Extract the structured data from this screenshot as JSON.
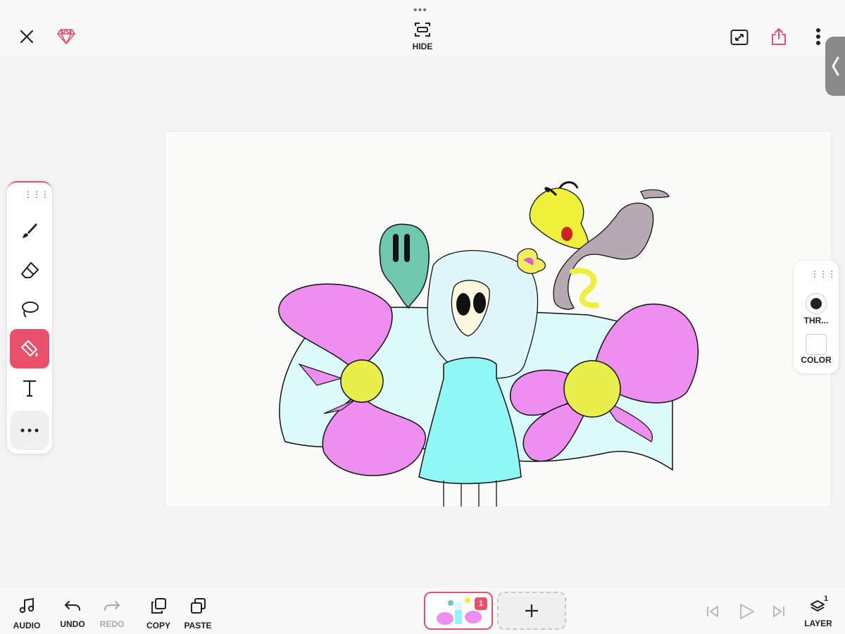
{
  "topbar": {
    "hide_label": "HIDE",
    "icons": [
      "close-icon",
      "gem-icon",
      "fullscreen-icon",
      "share-icon",
      "more-vertical-icon",
      "collapse-left-icon"
    ]
  },
  "toolbar": {
    "tools": [
      "brush-icon",
      "eraser-icon",
      "lasso-icon",
      "fill-bucket-icon",
      "text-icon",
      "more-icon"
    ],
    "active_tool": "fill-bucket-icon"
  },
  "side_panel": {
    "thickness_label": "THR...",
    "color_label": "COLOR"
  },
  "bottombar": {
    "audio_label": "AUDIO",
    "undo_label": "UNDO",
    "redo_label": "REDO",
    "copy_label": "COPY",
    "paste_label": "PASTE",
    "frame_number": "1",
    "layer_label": "LAYER",
    "layer_count": "1"
  },
  "colors": {
    "accent": "#e8506b",
    "canvas": "#fbfbf9",
    "bow_pink": "#ee8ef0",
    "dress_cyan": "#8ff7f5",
    "cape_light": "#dcfafa",
    "bow_center": "#e8ef4a",
    "ghost_teal": "#6fc7ad",
    "yellow_creature": "#eef03a",
    "gray_creature": "#b7a9b4"
  }
}
